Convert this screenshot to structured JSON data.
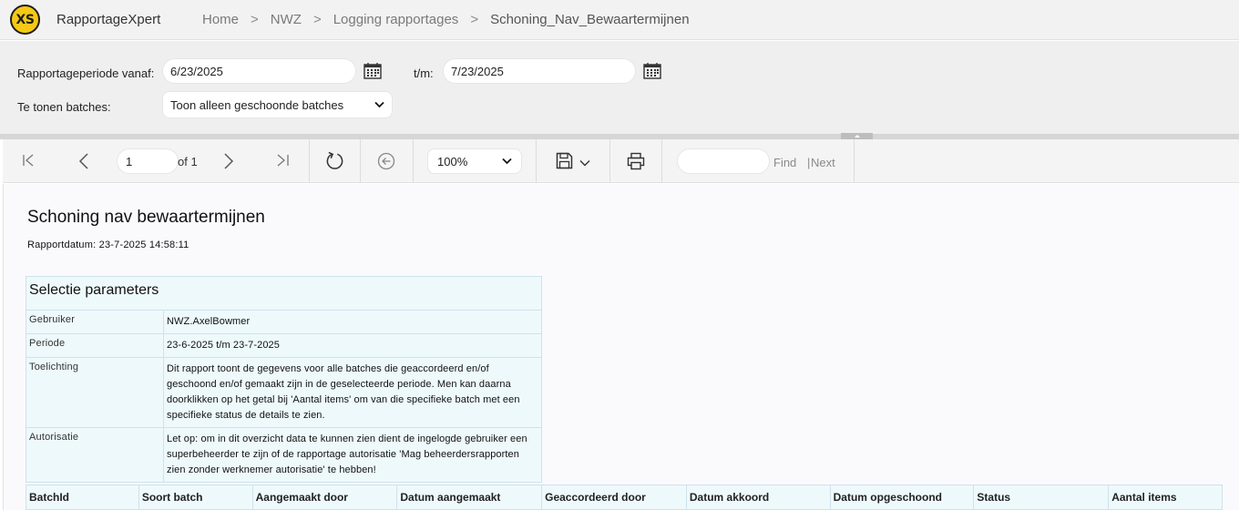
{
  "header": {
    "logo_text": "XS",
    "app_title": "RapportageXpert",
    "breadcrumb": [
      "Home",
      "NWZ",
      "Logging rapportages"
    ],
    "breadcrumb_current": "Schoning_Nav_Bewaartermijnen"
  },
  "params": {
    "period_from_label": "Rapportageperiode vanaf:",
    "period_from_value": "6/23/2025",
    "period_to_label": "t/m:",
    "period_to_value": "7/23/2025",
    "batches_label": "Te tonen batches:",
    "batches_selected": "Toon alleen geschoonde batches"
  },
  "toolbar": {
    "page_value": "1",
    "page_of": "of 1",
    "zoom": "100%",
    "find_label": "Find",
    "find_separator": "|",
    "next_label": "Next"
  },
  "report": {
    "title": "Schoning nav bewaartermijnen",
    "date_label": "Rapportdatum:",
    "date_value": "23-7-2025 14:58:11",
    "selection": {
      "header": "Selectie parameters",
      "rows": [
        {
          "key": "Gebruiker",
          "value": "NWZ.AxelBowmer"
        },
        {
          "key": "Periode",
          "value": "23-6-2025 t/m 23-7-2025"
        },
        {
          "key": "Toelichting",
          "value": "Dit rapport toont de gegevens voor alle batches die geaccordeerd en/of geschoond en/of gemaakt zijn in de geselecteerde periode. Men kan daarna doorklikken op het getal bij 'Aantal items' om van die specifieke batch met een specifieke status de details te zien."
        },
        {
          "key": "Autorisatie",
          "value": "Let op: om in dit overzicht data te kunnen zien dient de ingelogde gebruiker een superbeheerder te zijn of de rapportage autorisatie 'Mag beheerdersrapporten zien zonder werknemer autorisatie' te hebben!"
        }
      ]
    },
    "columns": [
      "BatchId",
      "Soort batch",
      "Aangemaakt door",
      "Datum aangemaakt",
      "Geaccordeerd door",
      "Datum akkoord",
      "Datum opgeschoond",
      "Status",
      "Aantal items"
    ]
  },
  "colors": {
    "logo_yellow": "#f6c915",
    "table_bg": "#eef9fc",
    "table_border": "#cfe2ea"
  },
  "icons": {
    "calendar": "calendar-icon",
    "first_page": "first-page-icon",
    "prev_page": "previous-page-icon",
    "next_page": "next-page-icon",
    "last_page": "last-page-icon",
    "refresh": "refresh-icon",
    "back": "back-icon",
    "save": "save-icon",
    "print": "print-icon"
  }
}
